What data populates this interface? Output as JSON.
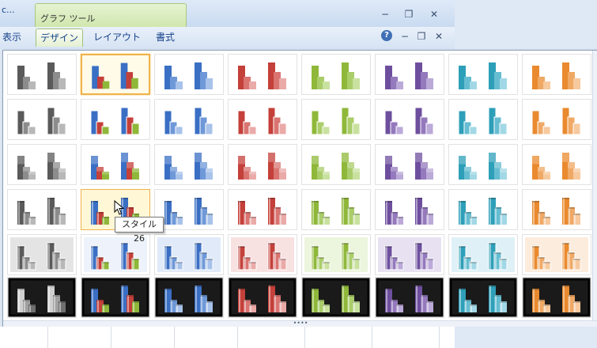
{
  "window": {
    "doc_title": "c...",
    "tools_group_label": "グラフ ツール",
    "btn_minimize": "−",
    "btn_restore": "❐",
    "btn_close": "✕"
  },
  "ribbon": {
    "tabs": [
      {
        "label": "表示"
      },
      {
        "label": "デザイン"
      },
      {
        "label": "レイアウト"
      },
      {
        "label": "書式"
      }
    ],
    "help": "?",
    "min": "−",
    "restore": "❐",
    "close": "✕"
  },
  "gallery": {
    "columns": 8,
    "rows": 6,
    "selected_style": 2,
    "hovered_style": 26,
    "tooltip": "スタイル 26",
    "palettes": [
      [
        "#5a5a5a",
        "#8c8c8c",
        "#b8b8b8"
      ],
      [
        "#3a6fc4",
        "#c4403a",
        "#8fb83a"
      ],
      [
        "#3a6fc4",
        "#6e98d8",
        "#a8c2ea"
      ],
      [
        "#c4403a",
        "#d97471",
        "#eaaaa8"
      ],
      [
        "#8fb83a",
        "#aacd6a",
        "#c9e19f"
      ],
      [
        "#6e4f9e",
        "#9479bd",
        "#bba9d8"
      ],
      [
        "#2e9fb8",
        "#66bdd1",
        "#a2d8e6"
      ],
      [
        "#ea8a2e",
        "#f0a965",
        "#f6c99e"
      ]
    ]
  },
  "grip": "••••"
}
